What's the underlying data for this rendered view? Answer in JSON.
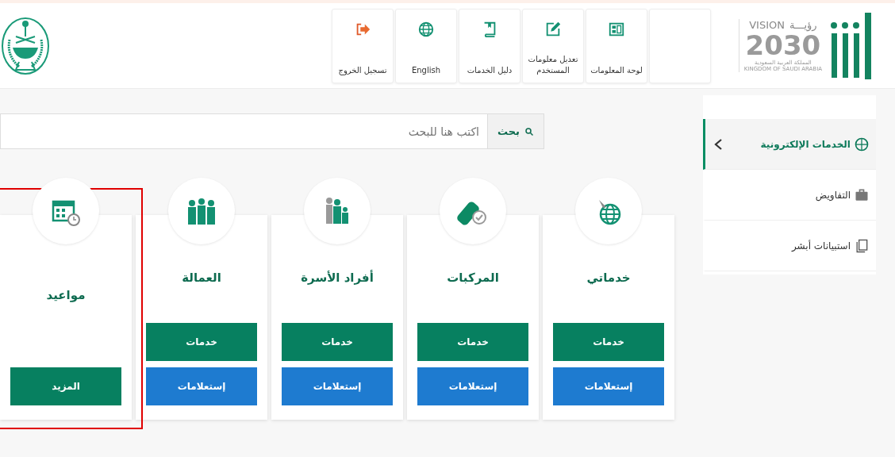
{
  "header": {
    "logo": {
      "vision_ar": "رؤيـــة",
      "vision_en": "VISION",
      "year": "2030",
      "country_ar": "المملكة العربية السعودية",
      "country_en": "KINGDOM OF SAUDI ARABIA"
    },
    "nav": [
      {
        "kind": "blank"
      },
      {
        "kind": "dashboard",
        "label": "لوحة المعلومات"
      },
      {
        "kind": "edit",
        "label": "تعديل معلومات المستخدم"
      },
      {
        "kind": "guide",
        "label": "دليل الخدمات"
      },
      {
        "kind": "language",
        "label": "English"
      },
      {
        "kind": "logout",
        "label": "تسجيل الخروج"
      }
    ]
  },
  "sidebar": {
    "items": [
      {
        "kind": "services",
        "label": "الخدمات الإلكترونية",
        "selected": true,
        "expanded": false
      },
      {
        "kind": "briefcase",
        "label": "التفاويض",
        "selected": false
      },
      {
        "kind": "survey",
        "label": "استبيانات أبشر",
        "selected": false
      }
    ]
  },
  "search": {
    "button": "بحث",
    "placeholder": "اكتب هنا للبحث"
  },
  "cards": [
    {
      "kind": "globe",
      "title": "خدماتي",
      "highlighted": false,
      "buttons": [
        {
          "kind": "primary",
          "label": "خدمات"
        },
        {
          "kind": "info",
          "label": "إستعلامات"
        }
      ]
    },
    {
      "kind": "vehicle",
      "title": "المركبات",
      "highlighted": false,
      "buttons": [
        {
          "kind": "primary",
          "label": "خدمات"
        },
        {
          "kind": "info",
          "label": "إستعلامات"
        }
      ]
    },
    {
      "kind": "family",
      "title": "أفراد الأسرة",
      "highlighted": false,
      "buttons": [
        {
          "kind": "primary",
          "label": "خدمات"
        },
        {
          "kind": "info",
          "label": "إستعلامات"
        }
      ]
    },
    {
      "kind": "workers",
      "title": "العمالة",
      "highlighted": false,
      "buttons": [
        {
          "kind": "primary",
          "label": "خدمات"
        },
        {
          "kind": "info",
          "label": "إستعلامات"
        }
      ]
    },
    {
      "kind": "calendar",
      "title": "مواعيد",
      "highlighted": true,
      "buttons": [
        {
          "kind": "primary",
          "label": "المزيد"
        }
      ]
    }
  ]
}
